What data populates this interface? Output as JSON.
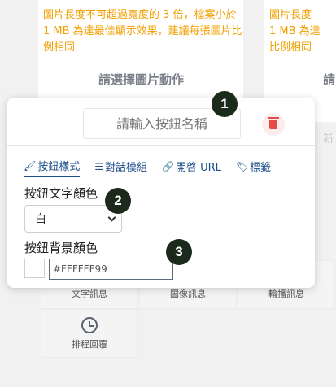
{
  "cards": {
    "left": {
      "warning": "圖片長度不可超過寬度的 3 倍，檔案小於 1 MB 為達最佳顯示效果，建議每張圖片比例相同",
      "action_title": "請選擇圖片動作"
    },
    "right": {
      "warning_lines": [
        "圖片長度",
        "1 MB 為達",
        "比例相同"
      ],
      "action_title": "請",
      "new_ghost": "新"
    }
  },
  "toolbar": {
    "items": [
      "文字訊息",
      "圖像訊息",
      "輪播訊息"
    ],
    "schedule_label": "排程回覆"
  },
  "popup": {
    "name_placeholder": "請輸入按鈕名稱",
    "tabs": [
      {
        "icon": "brush",
        "label": "按鈕樣式",
        "active": true
      },
      {
        "icon": "list",
        "label": "對話模組",
        "active": false
      },
      {
        "icon": "link",
        "label": "開啓 URL",
        "active": false
      },
      {
        "icon": "tag",
        "label": "標籤",
        "active": false
      }
    ],
    "text_color_label": "按鈕文字顏色",
    "text_color_value": "白",
    "bg_color_label": "按鈕背景顏色",
    "bg_color_value": "#FFFFFF99"
  },
  "annotations": [
    "1",
    "2",
    "3"
  ],
  "colors": {
    "accent": "#1e4f8a",
    "warning": "#f0a000",
    "danger": "#e44b4b",
    "badge": "#1c2a1c"
  }
}
